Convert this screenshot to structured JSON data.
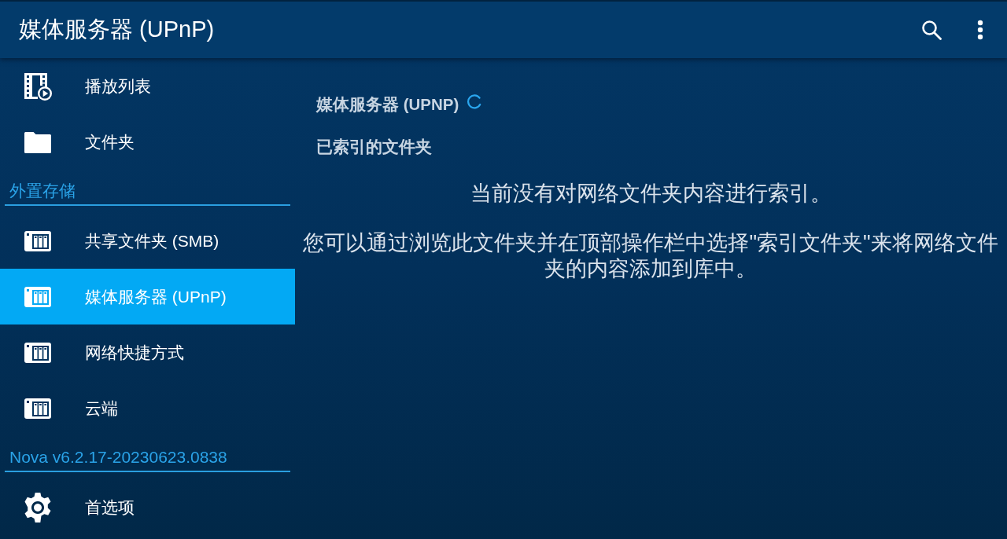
{
  "app_bar": {
    "title": "媒体服务器 (UPnP)"
  },
  "drawer": {
    "sections": [
      {
        "items": [
          {
            "kind": "playlist",
            "label": "播放列表",
            "selected": false
          },
          {
            "kind": "folder",
            "label": "文件夹",
            "selected": false
          }
        ]
      },
      {
        "header": "外置存储",
        "items": [
          {
            "kind": "storage",
            "label": "共享文件夹 (SMB)",
            "selected": false
          },
          {
            "kind": "storage",
            "label": "媒体服务器 (UPnP)",
            "selected": true
          },
          {
            "kind": "storage",
            "label": "网络快捷方式",
            "selected": false
          },
          {
            "kind": "storage",
            "label": "云端",
            "selected": false
          }
        ]
      },
      {
        "header": "Nova v6.2.17-20230623.0838",
        "items": [
          {
            "kind": "settings",
            "label": "首选项",
            "selected": false
          }
        ]
      }
    ]
  },
  "content": {
    "title": "媒体服务器 (UPNP)",
    "loading": true,
    "section_heading": "已索引的文件夹",
    "messages": [
      "当前没有对网络文件夹内容进行索引。",
      "您可以通过浏览此文件夹并在顶部操作栏中选择\"索引文件夹\"来将网络文件夹的内容添加到库中。"
    ]
  }
}
